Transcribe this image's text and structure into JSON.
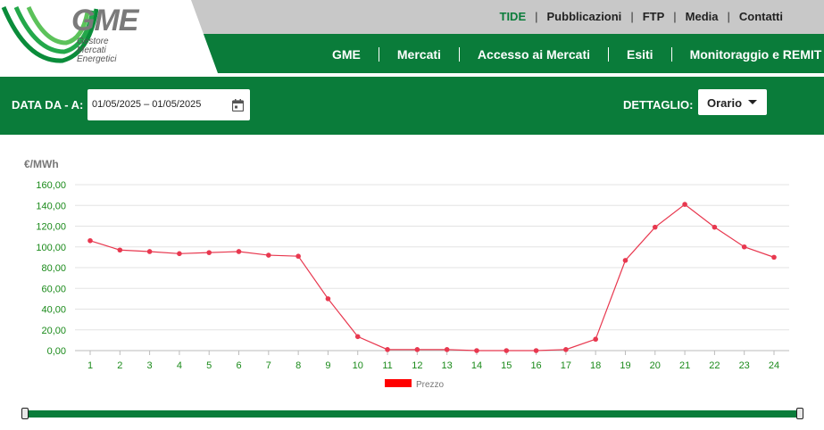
{
  "logo": {
    "name": "GME",
    "sub1": "Gestore",
    "sub2": "Mercati",
    "sub3": "Energetici"
  },
  "toplinks": [
    "TIDE",
    "Pubblicazioni",
    "FTP",
    "Media",
    "Contatti"
  ],
  "navlinks": [
    "GME",
    "Mercati",
    "Accesso ai Mercati",
    "Esiti",
    "Monitoraggio e REMIT"
  ],
  "filters": {
    "date_label": "DATA DA - A:",
    "date_value": "01/05/2025 – 01/05/2025",
    "detail_label": "DETTAGLIO:",
    "detail_value": "Orario"
  },
  "colors": {
    "brand_green": "#0a7c3a",
    "series_red": "#e8384f",
    "axis_green": "#1a8a1a"
  },
  "chart_data": {
    "type": "line",
    "title": "",
    "ylabel": "€/MWh",
    "xlabel": "",
    "ylim": [
      0,
      160
    ],
    "yticks": [
      "0,00",
      "20,00",
      "40,00",
      "60,00",
      "80,00",
      "100,00",
      "120,00",
      "140,00",
      "160,00"
    ],
    "categories": [
      "1",
      "2",
      "3",
      "4",
      "5",
      "6",
      "7",
      "8",
      "9",
      "10",
      "11",
      "12",
      "13",
      "14",
      "15",
      "16",
      "17",
      "18",
      "19",
      "20",
      "21",
      "22",
      "23",
      "24"
    ],
    "series": [
      {
        "name": "Prezzo",
        "values": [
          106,
          97,
          95.5,
          93.5,
          94.5,
          95.5,
          92,
          91,
          50,
          13.5,
          1,
          1,
          1,
          0,
          0,
          0,
          1,
          11,
          87,
          119,
          141,
          119,
          100,
          90
        ]
      }
    ],
    "legend_position": "bottom",
    "grid": true
  }
}
